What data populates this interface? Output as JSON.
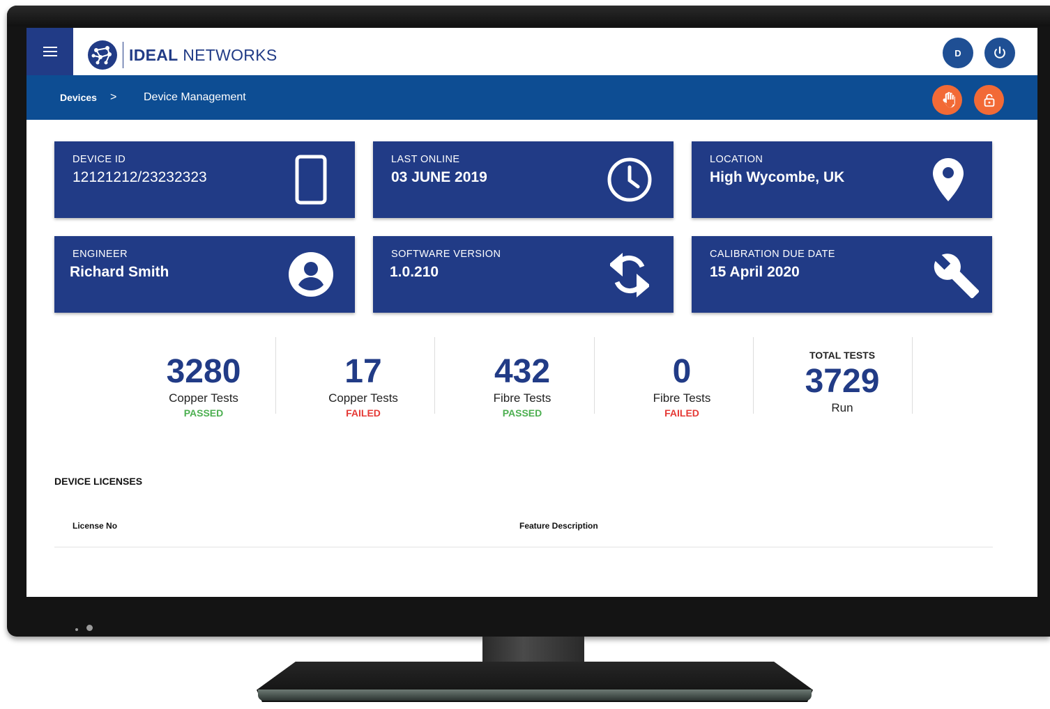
{
  "header": {
    "brand_bold": "IDEAL",
    "brand_light": "NETWORKS",
    "user_initial": "D"
  },
  "breadcrumb": {
    "root": "Devices",
    "separator": ">",
    "current": "Device Management"
  },
  "cards": [
    {
      "label": "DEVICE ID",
      "value": "12121212/23232323",
      "icon": "tablet-icon"
    },
    {
      "label": "LAST ONLINE",
      "value": "03 JUNE 2019",
      "icon": "clock-icon"
    },
    {
      "label": "LOCATION",
      "value": "High Wycombe, UK",
      "icon": "location-pin-icon"
    },
    {
      "label": "ENGINEER",
      "value": "Richard Smith",
      "icon": "account-icon"
    },
    {
      "label": "SOFTWARE VERSION",
      "value": "1.0.210",
      "icon": "sync-icon"
    },
    {
      "label": "CALIBRATION DUE DATE",
      "value": "15 April 2020",
      "icon": "wrench-icon"
    }
  ],
  "stats": [
    {
      "number": "3280",
      "label": "Copper Tests",
      "status": "PASSED"
    },
    {
      "number": "17",
      "label": "Copper Tests",
      "status": "FAILED"
    },
    {
      "number": "432",
      "label": "Fibre Tests",
      "status": "PASSED"
    },
    {
      "number": "0",
      "label": "Fibre Tests",
      "status": "FAILED"
    }
  ],
  "total": {
    "title": "TOTAL TESTS",
    "number": "3729",
    "label": "Run"
  },
  "licenses": {
    "title": "DEVICE LICENSES",
    "columns": [
      "License No",
      "Feature Description"
    ]
  },
  "colors": {
    "primary": "#213b86",
    "navbar": "#0d4d93",
    "accent": "#f26a36",
    "passed": "#4caf50",
    "failed": "#e53935"
  }
}
